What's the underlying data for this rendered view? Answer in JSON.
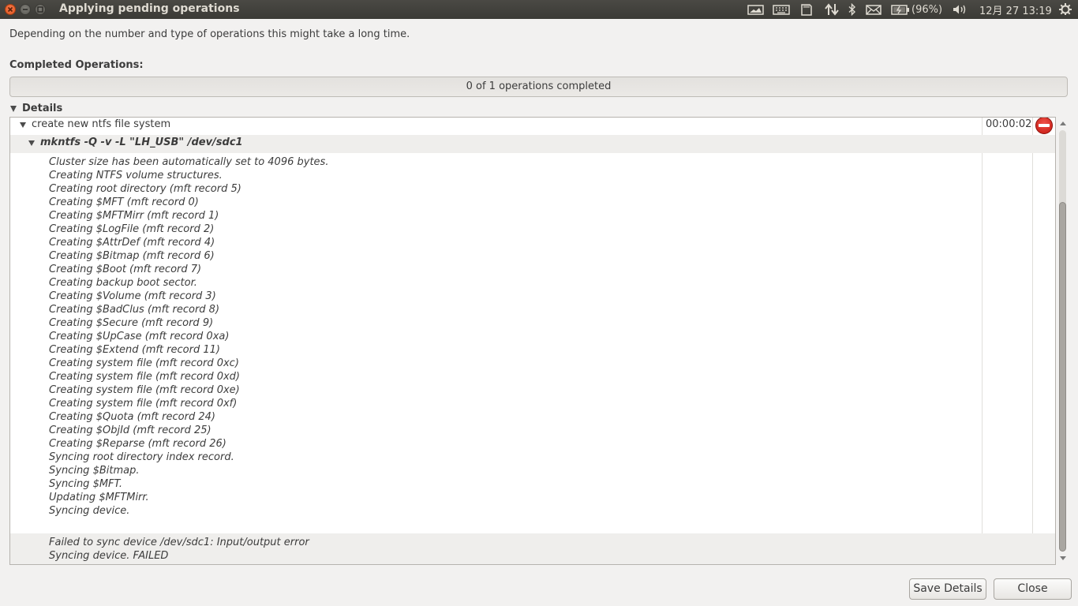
{
  "window": {
    "title": "Applying pending operations"
  },
  "tray": {
    "battery": "(96%)",
    "clock": "12月 27 13:19",
    "icons": [
      "workspace-icon",
      "keyboard-icon",
      "sd-card-icon",
      "network-icon",
      "bluetooth-icon",
      "mail-icon",
      "battery-icon",
      "volume-icon",
      "gear-icon"
    ]
  },
  "dialog": {
    "description": "Depending on the number and type of operations this might take a long time.",
    "completed_label": "Completed Operations:",
    "progress_text": "0 of 1 operations completed",
    "progress_fraction": 0,
    "details_label": "Details"
  },
  "tree": {
    "operation": {
      "label": "create new ntfs file system",
      "time": "00:00:02",
      "status_icon": "error-icon"
    },
    "command": {
      "label": "mkntfs -Q -v -L \"LH_USB\" /dev/sdc1"
    },
    "output_lines": [
      "Cluster size has been automatically set to 4096 bytes.",
      "Creating NTFS volume structures.",
      "Creating root directory (mft record 5)",
      "Creating $MFT (mft record 0)",
      "Creating $MFTMirr (mft record 1)",
      "Creating $LogFile (mft record 2)",
      "Creating $AttrDef (mft record 4)",
      "Creating $Bitmap (mft record 6)",
      "Creating $Boot (mft record 7)",
      "Creating backup boot sector.",
      "Creating $Volume (mft record 3)",
      "Creating $BadClus (mft record 8)",
      "Creating $Secure (mft record 9)",
      "Creating $UpCase (mft record 0xa)",
      "Creating $Extend (mft record 11)",
      "Creating system file (mft record 0xc)",
      "Creating system file (mft record 0xd)",
      "Creating system file (mft record 0xe)",
      "Creating system file (mft record 0xf)",
      "Creating $Quota (mft record 24)",
      "Creating $ObjId (mft record 25)",
      "Creating $Reparse (mft record 26)",
      "Syncing root directory index record.",
      "Syncing $Bitmap.",
      "Syncing $MFT.",
      "Updating $MFTMirr.",
      "Syncing device."
    ],
    "error_lines": [
      "Failed to sync device /dev/sdc1: Input/output error",
      "Syncing device. FAILED"
    ]
  },
  "scroll": {
    "thumb_start": 0.17,
    "thumb_end": 1.0
  },
  "buttons": {
    "save_details": "Save Details",
    "close": "Close"
  }
}
